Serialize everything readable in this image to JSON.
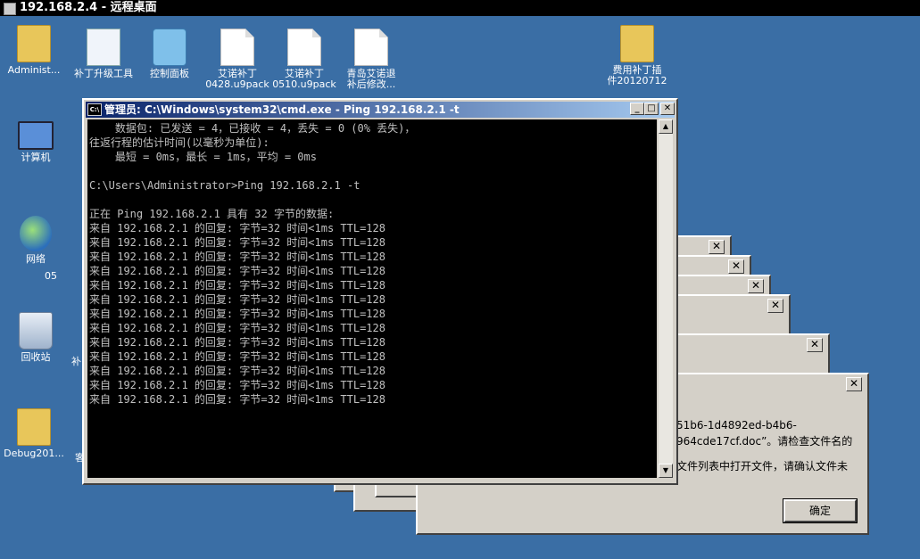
{
  "window": {
    "title": "192.168.2.4 - 远程桌面"
  },
  "desktop": {
    "icons": [
      {
        "label": "Administ...",
        "icon": "user-folder-icon"
      },
      {
        "label": "补丁升级工具",
        "icon": "tool-shortcut-icon"
      },
      {
        "label": "控制面板",
        "icon": "control-panel-icon"
      },
      {
        "label": "艾诺补丁0428.u9pack",
        "line1": "艾诺补丁",
        "line2": "0428.u9pack",
        "icon": "file-icon"
      },
      {
        "label": "艾诺补丁0510.u9pack",
        "line1": "艾诺补丁",
        "line2": "0510.u9pack",
        "icon": "file-icon"
      },
      {
        "label": "青岛艾诺退补后修改...",
        "line1": "青岛艾诺退",
        "line2": "补后修改...",
        "icon": "file-icon"
      },
      {
        "label": "费用补丁插件20120712",
        "line1": "费用补丁插",
        "line2": "件20120712",
        "icon": "folder-icon"
      },
      {
        "label": "计算机",
        "icon": "computer-icon"
      },
      {
        "label": "网络",
        "icon": "network-icon"
      },
      {
        "label": "回收站",
        "icon": "recycle-bin-icon"
      },
      {
        "label": "Debug201...",
        "icon": "folder-icon"
      }
    ],
    "partial_labels": {
      "p1": "05",
      "p2": "补",
      "p3": "客"
    }
  },
  "dialog": {
    "text1": "51b6-1d4892ed-b4b6-",
    "text2": "964cde17cf.doc”。请检查文件名的",
    "text3": "文件列表中打开文件，请确认文件未",
    "ok_label": "确定",
    "close_label": "✕"
  },
  "cmd": {
    "title": "管理员: C:\\Windows\\system32\\cmd.exe - Ping  192.168.2.1 -t",
    "icon_label": "C:\\",
    "lines": [
      "    数据包: 已发送 = 4，已接收 = 4，丢失 = 0 (0% 丢失)，",
      "往返行程的估计时间(以毫秒为单位):",
      "    最短 = 0ms，最长 = 1ms，平均 = 0ms",
      "",
      "C:\\Users\\Administrator>Ping 192.168.2.1 -t",
      "",
      "正在 Ping 192.168.2.1 具有 32 字节的数据:",
      "来自 192.168.2.1 的回复: 字节=32 时间<1ms TTL=128",
      "来自 192.168.2.1 的回复: 字节=32 时间<1ms TTL=128",
      "来自 192.168.2.1 的回复: 字节=32 时间<1ms TTL=128",
      "来自 192.168.2.1 的回复: 字节=32 时间<1ms TTL=128",
      "来自 192.168.2.1 的回复: 字节=32 时间<1ms TTL=128",
      "来自 192.168.2.1 的回复: 字节=32 时间<1ms TTL=128",
      "来自 192.168.2.1 的回复: 字节=32 时间<1ms TTL=128",
      "来自 192.168.2.1 的回复: 字节=32 时间<1ms TTL=128",
      "来自 192.168.2.1 的回复: 字节=32 时间<1ms TTL=128",
      "来自 192.168.2.1 的回复: 字节=32 时间<1ms TTL=128",
      "来自 192.168.2.1 的回复: 字节=32 时间<1ms TTL=128",
      "来自 192.168.2.1 的回复: 字节=32 时间<1ms TTL=128",
      "来自 192.168.2.1 的回复: 字节=32 时间<1ms TTL=128"
    ],
    "buttons": {
      "minimize": "_",
      "maximize": "□",
      "close": "✕"
    }
  },
  "colors": {
    "desktop": "#3a6ea5",
    "console_bg": "#000000",
    "console_text": "#c0c0c0",
    "title_active": "#0a246a"
  }
}
